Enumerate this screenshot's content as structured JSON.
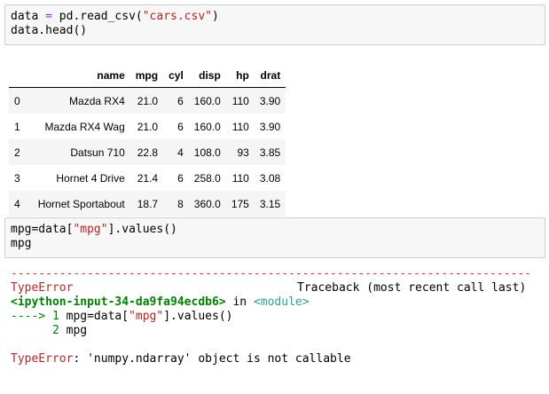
{
  "cell1": {
    "line1_var": "data",
    "line1_eq": " = ",
    "line1_call": "pd.read_csv(",
    "line1_str": "\"cars.csv\"",
    "line1_end": ")",
    "line2": "data.head()"
  },
  "table": {
    "columns": [
      "",
      "name",
      "mpg",
      "cyl",
      "disp",
      "hp",
      "drat"
    ],
    "rows": [
      [
        "0",
        "Mazda RX4",
        "21.0",
        "6",
        "160.0",
        "110",
        "3.90"
      ],
      [
        "1",
        "Mazda RX4 Wag",
        "21.0",
        "6",
        "160.0",
        "110",
        "3.90"
      ],
      [
        "2",
        "Datsun 710",
        "22.8",
        "4",
        "108.0",
        "93",
        "3.85"
      ],
      [
        "3",
        "Hornet 4 Drive",
        "21.4",
        "6",
        "258.0",
        "110",
        "3.08"
      ],
      [
        "4",
        "Hornet Sportabout",
        "18.7",
        "8",
        "360.0",
        "175",
        "3.15"
      ]
    ]
  },
  "cell2": {
    "line1_pre": "mpg=data[",
    "line1_str": "\"mpg\"",
    "line1_post": "].values()",
    "line2": "mpg"
  },
  "error": {
    "dashes": "---------------------------------------------------------------------------",
    "type": "TypeError",
    "traceback_label": "Traceback (most recent call last)",
    "input_ref": "<ipython-input-34-da9fa94ecdb6>",
    "in_word": " in ",
    "module": "<module>",
    "arrow": "---->",
    "line1_num": " 1 ",
    "line1_pre": "mpg=data[",
    "line1_str": "\"mpg\"",
    "line1_post": "].values()",
    "line2_indent": "      ",
    "line2_num": "2 ",
    "line2_code": "mpg",
    "final_type": "TypeError",
    "final_msg": ": 'numpy.ndarray' object is not callable"
  }
}
